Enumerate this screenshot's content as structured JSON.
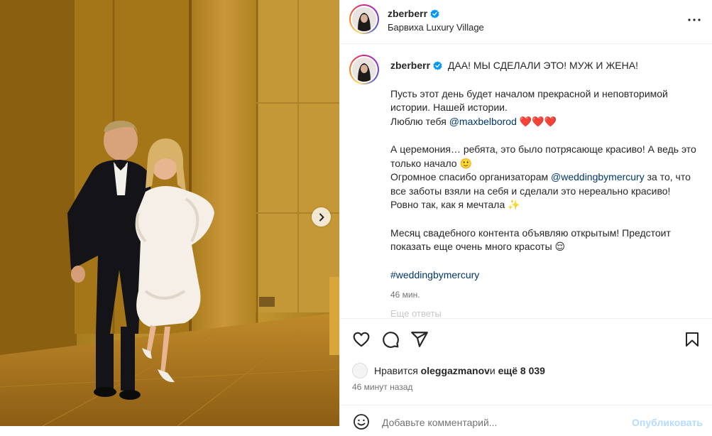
{
  "header": {
    "username": "zberberr",
    "location": "Барвиха Luxury Village"
  },
  "caption": {
    "username": "zberberr",
    "headline": "ДАА! МЫ СДЕЛАЛИ ЭТО! МУЖ И ЖЕНА!",
    "p1_line1": "Пусть этот день будет началом прекрасной и неповторимой истории. Нашей истории.",
    "p1_love_prefix": "Люблю тебя ",
    "p1_mention": "@maxbelborod",
    "p1_hearts": "❤️❤️❤️",
    "p2_text": "А церемония… ребята, это было потрясающе красиво! А ведь это только начало 🙂",
    "p2_thanks_prefix": "Огромное спасибо организаторам ",
    "p2_mention": "@weddingbymercury",
    "p2_thanks_suffix": " за то, что все заботы взяли на себя и сделали это нереально красиво! Ровно так, как я мечтала ✨",
    "p3_text": "Месяц свадебного контента объявляю открытым! Предстоит показать еще очень много красоты 😌",
    "hashtag": "#weddingbymercury",
    "time": "46 мин.",
    "faded_more": "Еще ответы"
  },
  "likes": {
    "prefix": "Нравится ",
    "user": "oleggazmanov",
    "middle": " и ",
    "count": "ещё 8 039"
  },
  "post_time": "46 минут назад",
  "comment": {
    "placeholder": "Добавьте комментарий...",
    "publish_label": "Опубликовать"
  },
  "icons": {
    "like": "heart-icon",
    "comment": "comment-icon",
    "share": "share-icon",
    "save": "bookmark-icon",
    "more": "more-icon",
    "next": "chevron-right-icon",
    "verified": "verified-badge-icon",
    "emoji": "emoji-icon"
  },
  "colors": {
    "link": "#00376b",
    "verified": "#0095f6",
    "muted": "#737373",
    "publish_disabled": "#b3dbff"
  }
}
